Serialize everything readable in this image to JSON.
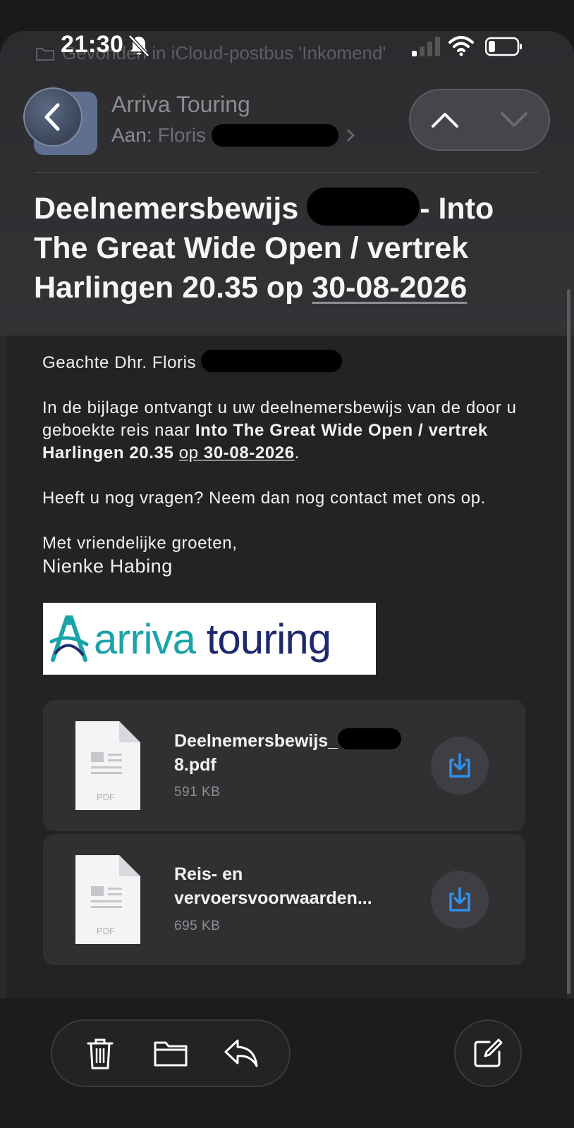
{
  "status_bar": {
    "time": "21:30",
    "icons": [
      "bell-slash-icon",
      "cellular-icon",
      "wifi-icon",
      "battery-icon"
    ]
  },
  "mailbox_label": "Gevonden in iCloud-postbus 'Inkomend'",
  "header": {
    "sender": "Arriva Touring",
    "recipient_prefix": "Aan:",
    "recipient_name": "Floris"
  },
  "subject": {
    "before_redaction": "Deelnemersbewijs",
    "after_redaction": "- Into The Great Wide Open / vertrek Harlingen 20.35 op",
    "date": "30-08-2026"
  },
  "body": {
    "greeting": "Geachte Dhr. Floris",
    "p1_start": "In de bijlage ontvangt u uw deelnemersbewijs van de door u geboekte reis naar",
    "p1_bold": "Into The Great Wide Open / vertrek Harlingen 20.35",
    "p1_op": "op",
    "p1_date": "30-08-2026",
    "p1_end": ".",
    "p2": "Heeft u nog vragen? Neem dan nog contact met ons op.",
    "closing": "Met vriendelijke groeten,",
    "signature": "Nienke Habing"
  },
  "logo": {
    "word1": "arriva",
    "word2": "touring",
    "colors": {
      "arriva": "#1aa3a8",
      "touring": "#1e2a6e"
    }
  },
  "attachments": [
    {
      "name_part1": "Deelnemersbewijs_",
      "name_part2": "8.pdf",
      "size": "591 KB",
      "icon_label": "PDF"
    },
    {
      "name_part1": "Reis- en",
      "name_part2": "vervoersvoorwaarden...",
      "size": "695 KB",
      "icon_label": "PDF"
    }
  ],
  "toolbar": {
    "buttons": [
      "trash-icon",
      "folder-icon",
      "reply-icon"
    ],
    "compose": "compose-icon"
  },
  "colors": {
    "accent": "#2f8ff0",
    "background": "#232325"
  }
}
